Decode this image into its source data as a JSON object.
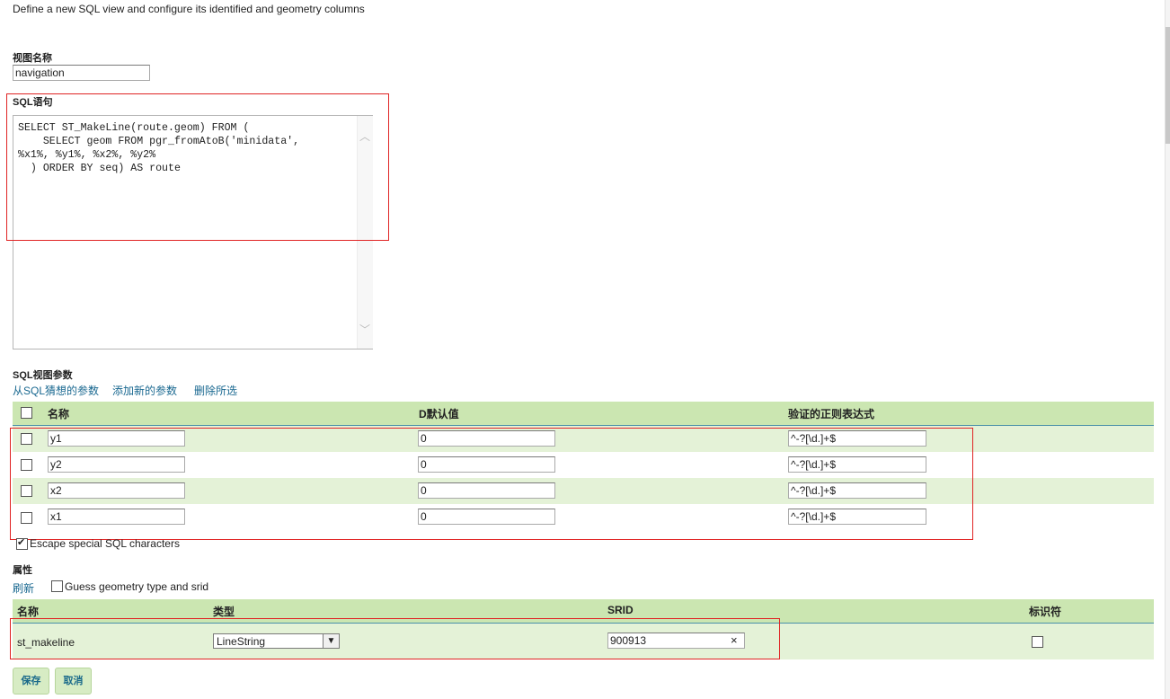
{
  "description": "Define a new SQL view and configure its identified and geometry columns",
  "view_name": {
    "label": "视图名称",
    "value": "navigation"
  },
  "sql": {
    "label": "SQL语句",
    "text": "SELECT ST_MakeLine(route.geom) FROM (\n    SELECT geom FROM pgr_fromAtoB('minidata',\n%x1%, %y1%, %x2%, %y2%\n  ) ORDER BY seq) AS route"
  },
  "params": {
    "label": "SQL视图参数",
    "links": [
      "从SQL猜想的参数",
      "添加新的参数",
      "删除所选"
    ],
    "headers": {
      "name": "名称",
      "default": "D默认值",
      "regex": "验证的正则表达式"
    },
    "rows": [
      {
        "name": "y1",
        "default": "0",
        "regex": "^-?[\\d.]+$"
      },
      {
        "name": "y2",
        "default": "0",
        "regex": "^-?[\\d.]+$"
      },
      {
        "name": "x2",
        "default": "0",
        "regex": "^-?[\\d.]+$"
      },
      {
        "name": "x1",
        "default": "0",
        "regex": "^-?[\\d.]+$"
      }
    ]
  },
  "escape": {
    "label": "Escape special SQL characters",
    "checked": true
  },
  "attributes": {
    "label": "属性",
    "refresh": "刷新",
    "guess_label": "Guess geometry type and srid",
    "headers": {
      "name": "名称",
      "type": "类型",
      "srid": "SRID",
      "identifier": "标识符"
    },
    "row": {
      "name": "st_makeline",
      "type": "LineString",
      "srid": "900913"
    }
  },
  "buttons": {
    "save": "保存",
    "cancel": "取消"
  },
  "colors": {
    "header_bg": "#cbe6b1",
    "row_alt_bg": "#e4f2d7",
    "link": "#196890",
    "highlight": "#e02424"
  }
}
